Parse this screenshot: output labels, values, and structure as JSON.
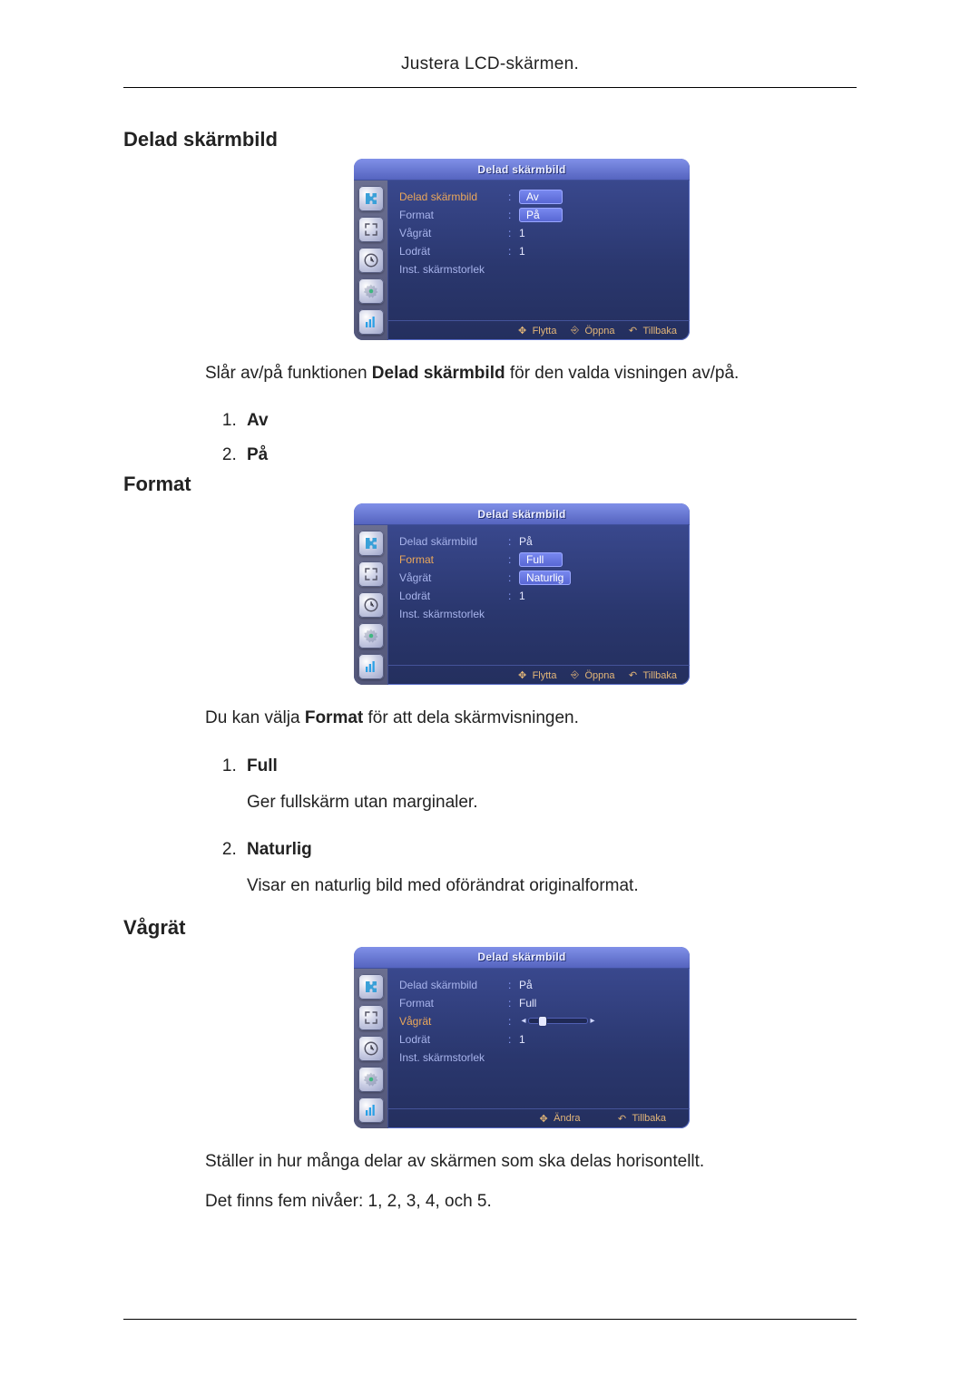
{
  "header": "Justera LCD-skärmen.",
  "sections": {
    "s1": {
      "title": "Delad skärmbild"
    },
    "s2": {
      "title": "Format"
    },
    "s3": {
      "title": "Vågrät"
    }
  },
  "s1": {
    "body_pre": "Slår av/på funktionen ",
    "body_bold": "Delad skärmbild",
    "body_post": " för den valda visningen av/på.",
    "opts": {
      "o1": "Av",
      "o2": "På"
    }
  },
  "s2": {
    "body_pre": "Du kan välja ",
    "body_bold": "Format",
    "body_post": " för att dela skärmvisningen.",
    "opts": {
      "o1": {
        "t": "Full",
        "d": "Ger fullskärm utan marginaler."
      },
      "o2": {
        "t": "Naturlig",
        "d": "Visar en naturlig bild med oförändrat originalformat."
      }
    }
  },
  "s3": {
    "body1": "Ställer in hur många delar av skärmen som ska delas horisontellt.",
    "body2": "Det finns fem nivåer: 1, 2, 3, 4, och 5."
  },
  "osd_common": {
    "title": "Delad skärmbild",
    "rows": {
      "delad": "Delad skärmbild",
      "format": "Format",
      "vagrat": "Vågrät",
      "lodrat": "Lodrät",
      "inst": "Inst. skärmstorlek"
    },
    "footer": {
      "flytta": "Flytta",
      "oppna": "Öppna",
      "tillbaka": "Tillbaka",
      "andra": "Ändra"
    },
    "vals": {
      "av": "Av",
      "pa": "På",
      "one": "1",
      "full": "Full",
      "naturlig": "Naturlig"
    }
  },
  "icons": {
    "puzzle": "puzzle-icon",
    "expand": "expand-icon",
    "clock": "clock-icon",
    "gear": "gear-icon",
    "chart": "chart-icon",
    "move": "move-arrows-icon",
    "enter": "enter-icon",
    "return": "return-icon"
  }
}
